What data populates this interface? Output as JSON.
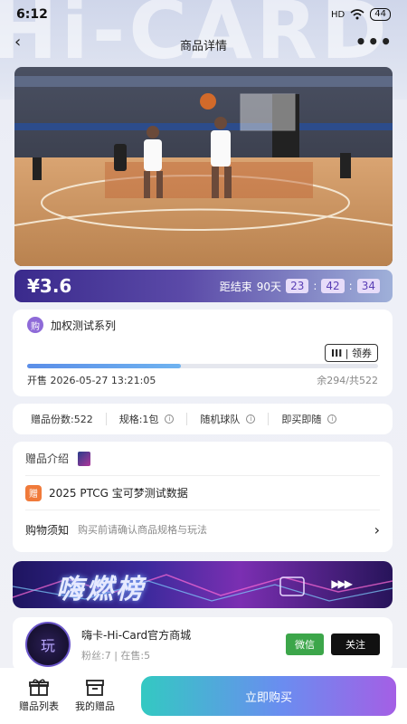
{
  "status": {
    "time": "6:12",
    "network": "HD",
    "battery": "44"
  },
  "nav": {
    "title": "商品详情"
  },
  "price": {
    "amount": "¥3.6",
    "countdown_label": "距结束",
    "days": "90天",
    "hours": "23",
    "minutes": "42",
    "seconds": "34"
  },
  "series": {
    "badge": "购",
    "name": "加权测试系列",
    "coupon": "领券",
    "coupon_icon": "III",
    "sale_time": "开售 2026-05-27 13:21:05",
    "stock": "余294/共522",
    "progress": 0.437
  },
  "specs": {
    "count": "赠品份数:522",
    "spec": "规格:1包",
    "team": "随机球队",
    "mode": "即买即随"
  },
  "intro": {
    "title": "赠品介绍",
    "gift_tag": "赠",
    "gift_name": "2025 PTCG 宝可梦测试数据",
    "notice_label": "购物须知",
    "notice_desc": "购买前请确认商品规格与玩法"
  },
  "banner": {
    "title": "嗨燃榜"
  },
  "shop": {
    "avatar_text": "玩",
    "name": "嗨卡-Hi-Card官方商城",
    "fans": "粉丝:7",
    "on_sale": "在售:5",
    "wechat": "微信",
    "follow": "关注"
  },
  "bottom": {
    "gift_list": "赠品列表",
    "my_gifts": "我的赠品",
    "buy": "立即购买"
  },
  "colors": {
    "accent": "#5b4aa8",
    "wechat": "#3ca64a"
  }
}
